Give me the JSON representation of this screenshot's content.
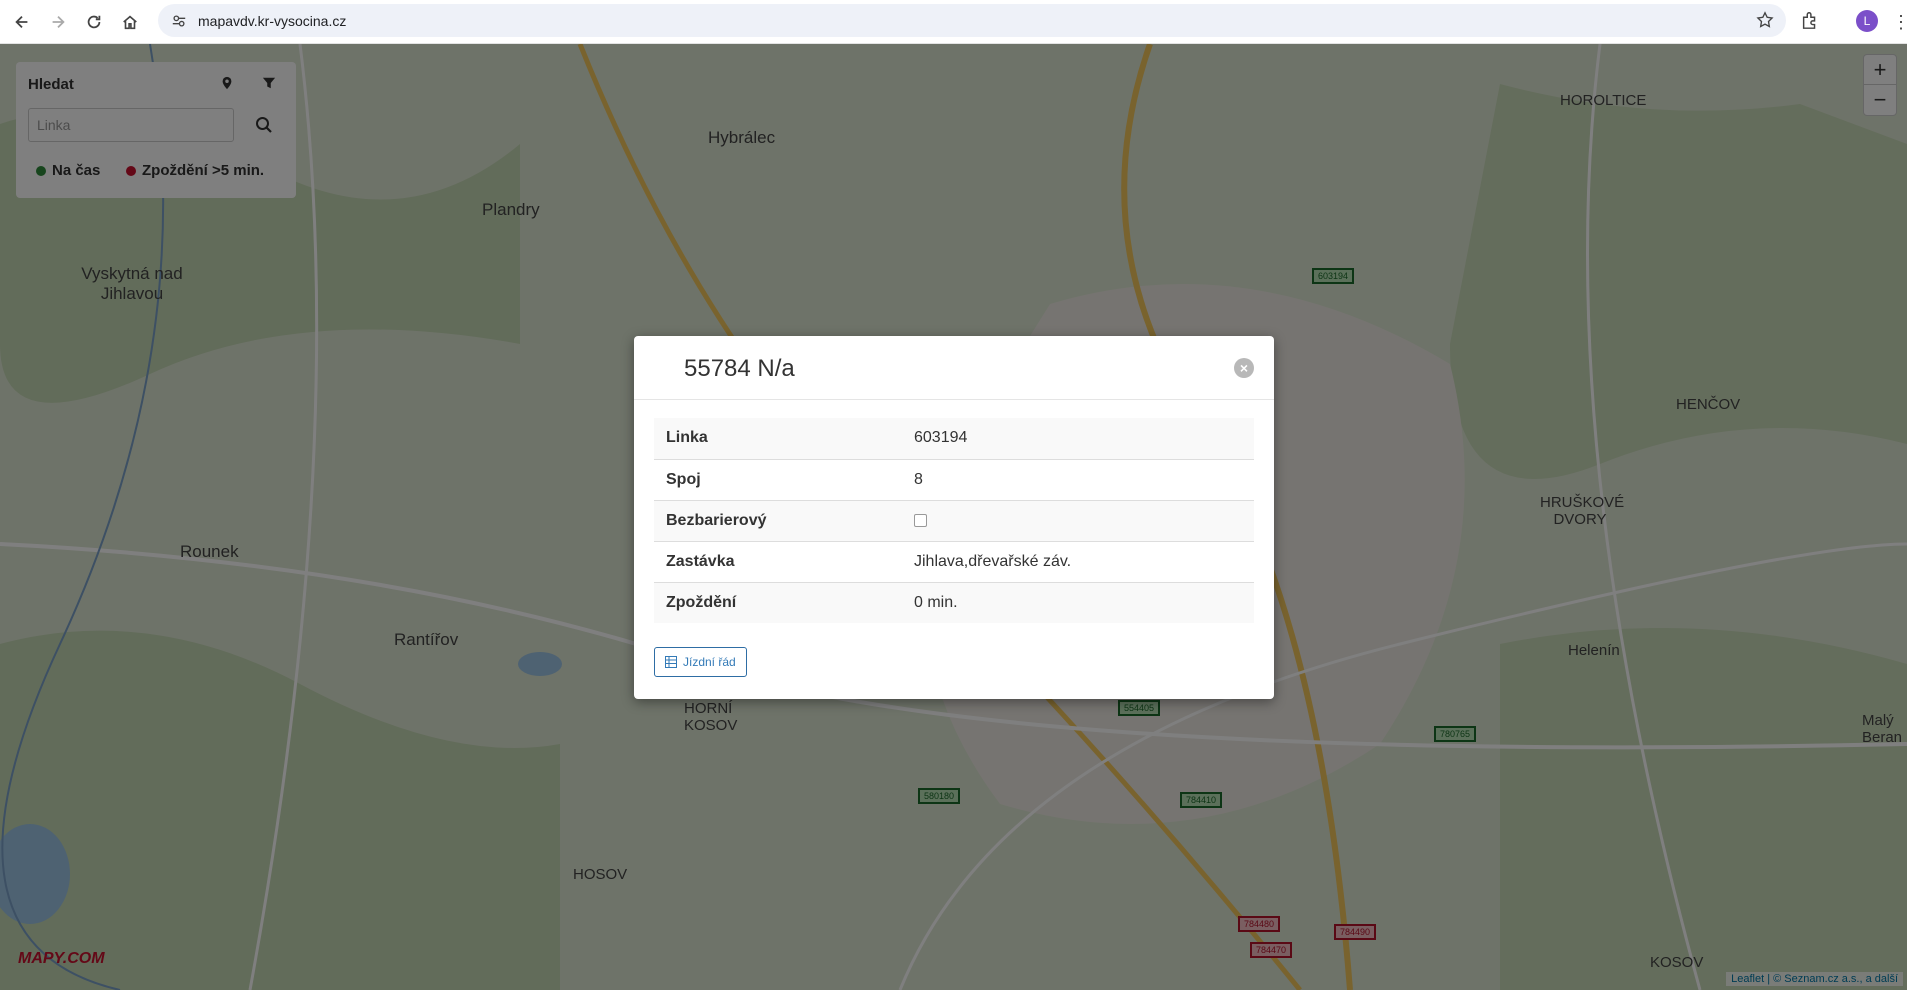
{
  "browser": {
    "url": "mapavdv.kr-vysocina.cz",
    "profile_initial": "L",
    "icons": [
      "back-arrow",
      "forward-arrow",
      "reload",
      "home",
      "site-info",
      "star",
      "extensions",
      "kebab-menu"
    ]
  },
  "map": {
    "places": [
      {
        "name": "Hybrálec",
        "size": "large"
      },
      {
        "name": "Plandry",
        "size": "large"
      },
      {
        "name": "Vyskytná nad Jihlavou",
        "size": "large"
      },
      {
        "name": "Rounek",
        "size": "large"
      },
      {
        "name": "Rantířov",
        "size": "large"
      },
      {
        "name": "HOROLTICE",
        "size": "medium"
      },
      {
        "name": "HENČOV",
        "size": "medium"
      },
      {
        "name": "HRUŠKOVÉ DVORY",
        "size": "medium"
      },
      {
        "name": "Helenín",
        "size": "medium"
      },
      {
        "name": "HORNÍ KOSOV",
        "size": "medium"
      },
      {
        "name": "HOSOV",
        "size": "medium"
      },
      {
        "name": "KOSOV",
        "size": "medium"
      },
      {
        "name": "Malý Beran",
        "size": "medium"
      }
    ],
    "vehicles": [
      {
        "label": "603194",
        "status": "ontime"
      },
      {
        "label": "554405",
        "status": "ontime"
      },
      {
        "label": "780765",
        "status": "ontime"
      },
      {
        "label": "580180",
        "status": "ontime"
      },
      {
        "label": "784410",
        "status": "ontime"
      },
      {
        "label": "784480",
        "status": "late"
      },
      {
        "label": "784470",
        "status": "late"
      },
      {
        "label": "784490",
        "status": "late"
      }
    ],
    "search_panel": {
      "title": "Hledat",
      "placeholder": "Linka",
      "legend_ontime": "Na čas",
      "legend_late": "Zpoždění >5 min.",
      "color_ontime": "#2e8b3a",
      "color_late": "#c8102e"
    },
    "logo": "MAPY.COM",
    "attribution": "Leaflet | © Seznam.cz a.s., a další"
  },
  "modal": {
    "title": "55784 N/a",
    "rows": [
      {
        "label": "Linka",
        "value": "603194"
      },
      {
        "label": "Spoj",
        "value": "8"
      },
      {
        "label": "Bezbarierový",
        "value": ""
      },
      {
        "label": "Zastávka",
        "value": "Jihlava,dřevařské záv."
      },
      {
        "label": "Zpoždění",
        "value": "0 min."
      }
    ],
    "timetable_button": "Jízdní řád"
  }
}
